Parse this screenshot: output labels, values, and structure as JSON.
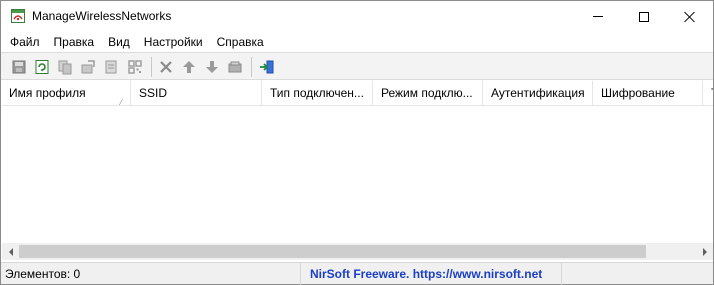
{
  "window": {
    "title": "ManageWirelessNetworks"
  },
  "menu": [
    {
      "label": "Файл",
      "name": "menu-file"
    },
    {
      "label": "Правка",
      "name": "menu-edit"
    },
    {
      "label": "Вид",
      "name": "menu-view"
    },
    {
      "label": "Настройки",
      "name": "menu-settings"
    },
    {
      "label": "Справка",
      "name": "menu-help"
    }
  ],
  "toolbar": {
    "buttons": [
      {
        "icon": "save-icon"
      },
      {
        "icon": "refresh-icon"
      },
      {
        "icon": "copy-icon"
      },
      {
        "icon": "export-icon"
      },
      {
        "icon": "properties-icon"
      },
      {
        "icon": "qr-code-icon"
      },
      {
        "icon": "delete-icon"
      },
      {
        "icon": "move-up-icon"
      },
      {
        "icon": "move-down-icon"
      },
      {
        "icon": "connect-icon"
      },
      {
        "icon": "exit-icon"
      }
    ]
  },
  "list": {
    "columns": [
      {
        "label": "Имя профиля",
        "sorted": true
      },
      {
        "label": "SSID"
      },
      {
        "label": "Тип подключен..."
      },
      {
        "label": "Режим подклю..."
      },
      {
        "label": "Аутентификация"
      },
      {
        "label": "Шифрование"
      },
      {
        "label": "Т"
      }
    ],
    "rows": []
  },
  "status": {
    "items_count": "Элементов: 0",
    "link_text": "NirSoft Freeware. https://www.nirsoft.net"
  },
  "colors": {
    "link": "#1a3fc7",
    "toolbar_bg": "#f3f3f3",
    "statusbar_bg": "#f0f0f0"
  }
}
